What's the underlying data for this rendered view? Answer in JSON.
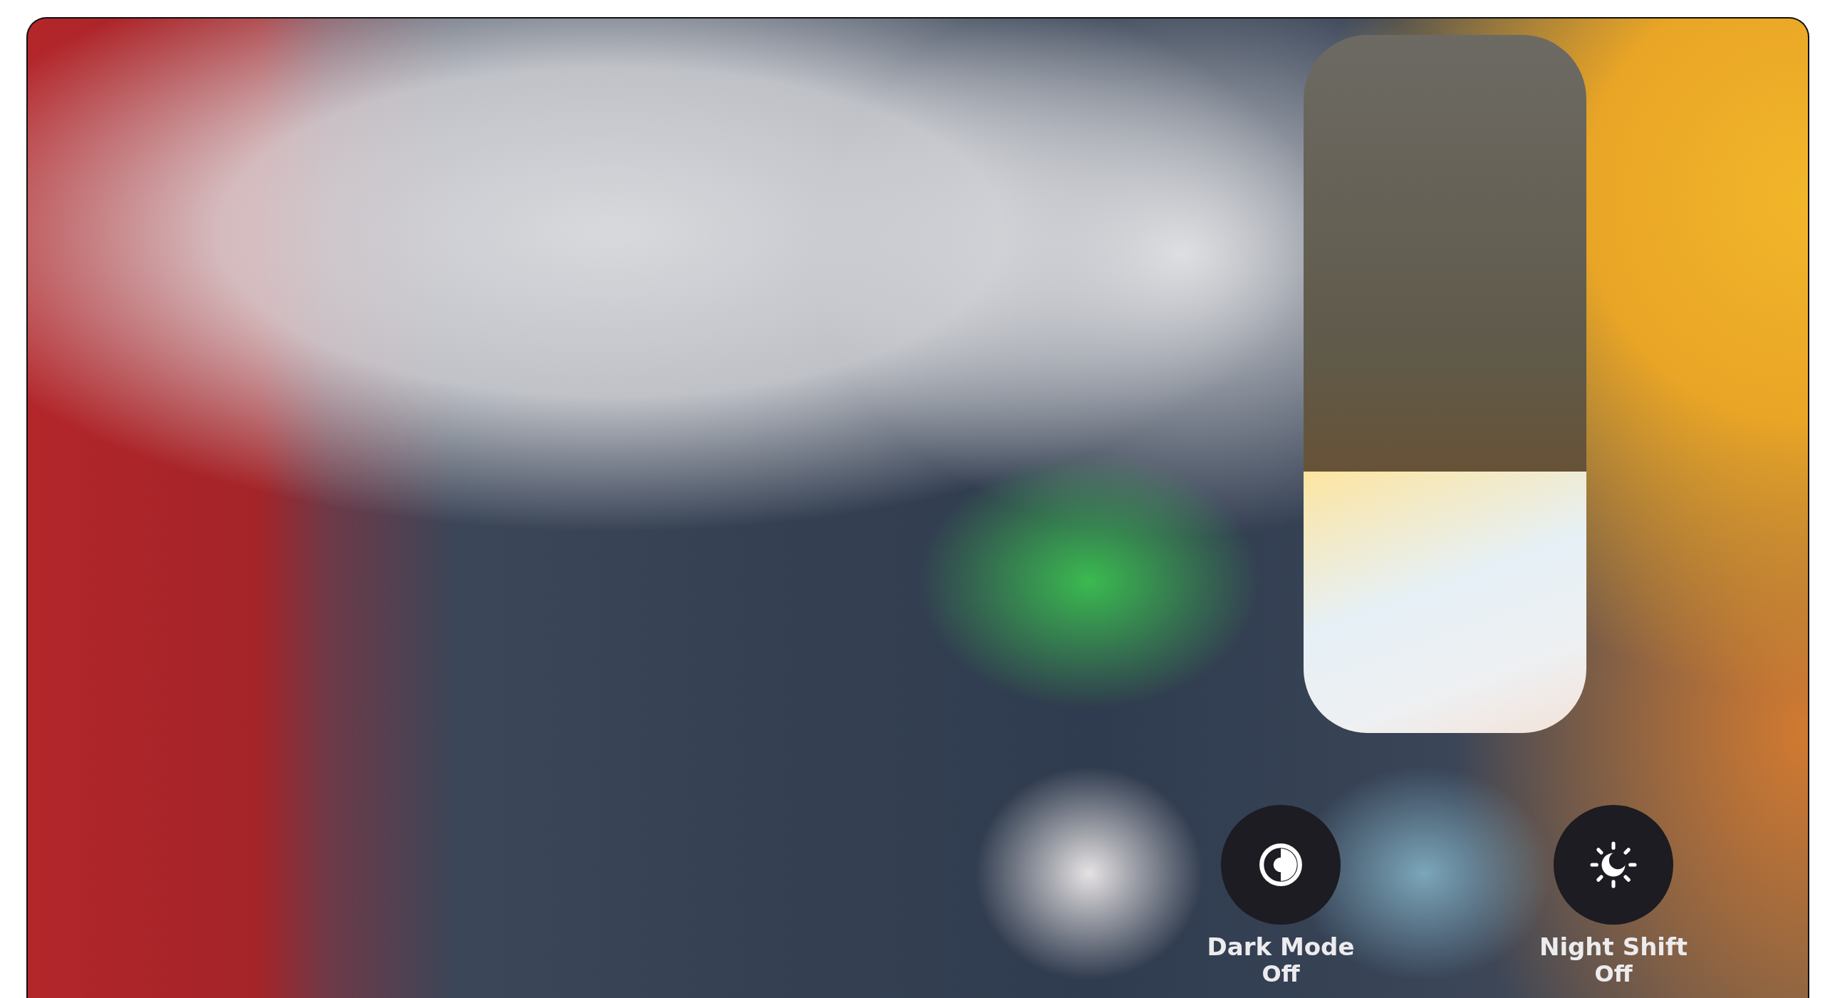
{
  "brightness": {
    "level": 0.375
  },
  "toggles": [
    {
      "kind": "dark_mode",
      "label": "Dark Mode",
      "status": "Off",
      "on": false
    },
    {
      "kind": "night_shift",
      "label": "Night Shift",
      "status": "Off",
      "on": false
    }
  ]
}
